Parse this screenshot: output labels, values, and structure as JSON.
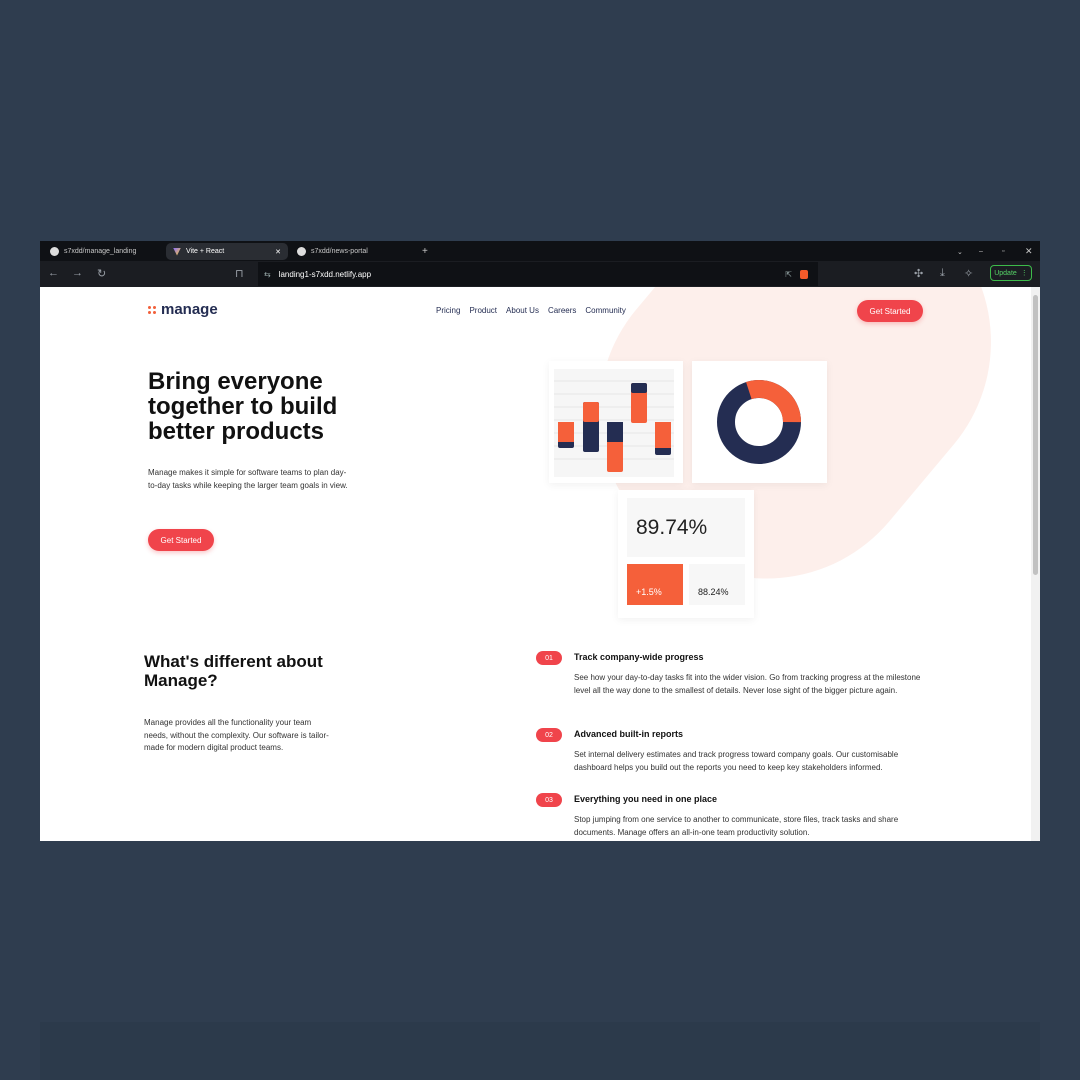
{
  "browser": {
    "tabs": [
      {
        "label": "s7xdd/manage_landing",
        "icon": "github-icon"
      },
      {
        "label": "Vite + React",
        "icon": "vite-icon",
        "active": true
      },
      {
        "label": "s7xdd/news-portal",
        "icon": "github-icon"
      }
    ],
    "url": "landing1-s7xdd.netlify.app",
    "update_label": "Update"
  },
  "nav": {
    "logo": "manage",
    "links": [
      "Pricing",
      "Product",
      "About Us",
      "Careers",
      "Community"
    ],
    "cta": "Get Started"
  },
  "hero": {
    "title": "Bring everyone together to build better products",
    "description": "Manage makes it simple for software teams to plan day-to-day tasks while keeping the larger team goals in view.",
    "cta": "Get Started"
  },
  "dashboard": {
    "main_stat": "89.74%",
    "change": "+1.5%",
    "secondary_stat": "88.24%",
    "donut_orange_fraction": 0.3,
    "colors": {
      "orange": "#f5603a",
      "navy": "#242d52",
      "red": "#f0444b"
    }
  },
  "about": {
    "title": "What's different about Manage?",
    "description": "Manage provides all the functionality your team needs, without the complexity. Our software is tailor-made for modern digital product teams."
  },
  "features": [
    {
      "num": "01",
      "title": "Track company-wide progress",
      "description": "See how your day-to-day tasks fit into the wider vision. Go from tracking progress at the milestone level all the way done to the smallest of details. Never lose sight of the bigger picture again."
    },
    {
      "num": "02",
      "title": "Advanced built-in reports",
      "description": "Set internal delivery estimates and track progress toward company goals. Our customisable dashboard helps you build out the reports you need to keep key stakeholders informed."
    },
    {
      "num": "03",
      "title": "Everything you need in one place",
      "description": "Stop jumping from one service to another to communicate, store files, track tasks and share documents. Manage offers an all-in-one team productivity solution."
    }
  ]
}
